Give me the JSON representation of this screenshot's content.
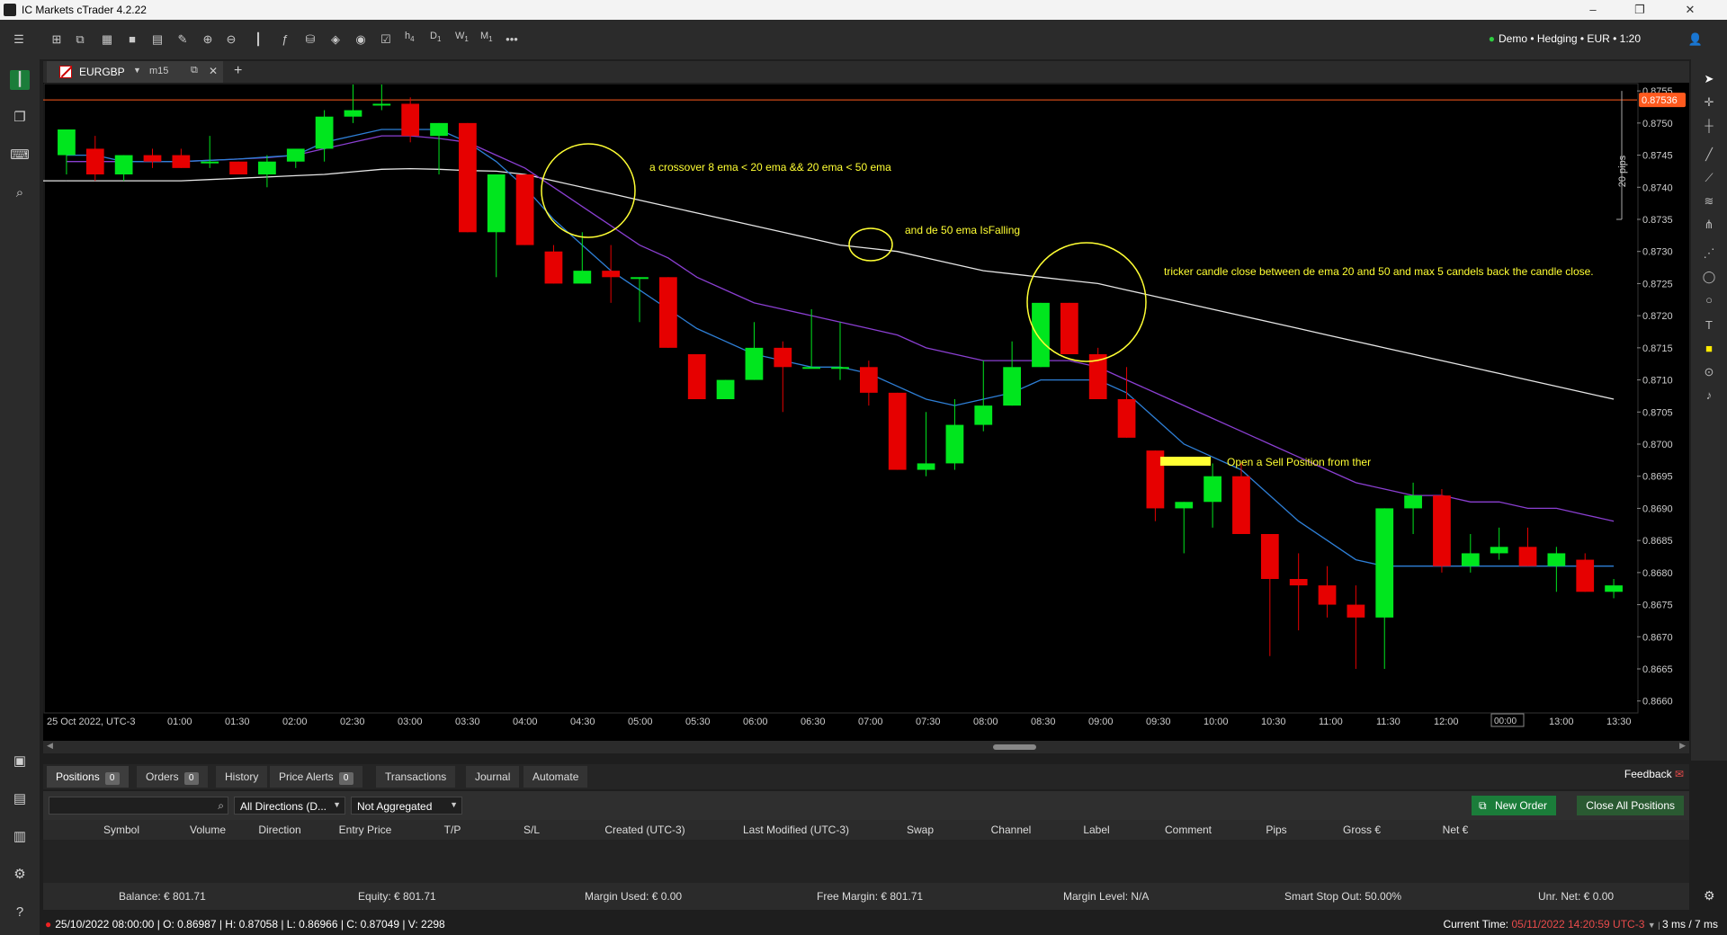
{
  "window": {
    "title": "IC Markets cTrader 4.2.22",
    "buttons": [
      "–",
      "❐",
      "✕"
    ]
  },
  "toolbar": {
    "timeframes": [
      {
        "main": "h",
        "sub": "4"
      },
      {
        "main": "D",
        "sub": "1"
      },
      {
        "main": "W",
        "sub": "1"
      },
      {
        "main": "M",
        "sub": "1"
      }
    ],
    "more": "•••",
    "account": "Demo • Hedging • EUR • 1:20"
  },
  "chart_tab": {
    "symbol": "EURGBP",
    "timeframe": "m15"
  },
  "chart_data": {
    "type": "candlestick",
    "symbol": "EURGBP",
    "timeframe": "m15",
    "ylim": [
      0.8658,
      0.8756
    ],
    "y_ticks": [
      0.8755,
      0.875,
      0.8745,
      0.874,
      0.8735,
      0.873,
      0.8725,
      0.872,
      0.8715,
      0.871,
      0.8705,
      0.87,
      0.8695,
      0.869,
      0.8685,
      0.868,
      0.8675,
      0.867,
      0.8665,
      0.866
    ],
    "x_ticks": [
      "25 Oct 2022, UTC-3",
      "01:00",
      "01:30",
      "02:00",
      "02:30",
      "03:00",
      "03:30",
      "04:00",
      "04:30",
      "05:00",
      "05:30",
      "06:00",
      "06:30",
      "07:00",
      "07:30",
      "08:00",
      "08:30",
      "09:00",
      "09:30",
      "10:00",
      "10:30",
      "11:00",
      "11:30",
      "12:00",
      "12:30",
      "13:00",
      "13:30"
    ],
    "current_price": "0.87536",
    "candles": [
      [
        0.8745,
        0.8747,
        0.8742,
        0.8749
      ],
      [
        0.8746,
        0.8748,
        0.8741,
        0.8742
      ],
      [
        0.8742,
        0.8745,
        0.8741,
        0.8745
      ],
      [
        0.8745,
        0.8746,
        0.8743,
        0.8744
      ],
      [
        0.8745,
        0.8746,
        0.8743,
        0.8743
      ],
      [
        0.8744,
        0.8748,
        0.8743,
        0.8744
      ],
      [
        0.8744,
        0.8744,
        0.8742,
        0.8742
      ],
      [
        0.8742,
        0.8745,
        0.874,
        0.8744
      ],
      [
        0.8744,
        0.8745,
        0.8743,
        0.8746
      ],
      [
        0.8746,
        0.8752,
        0.8744,
        0.8751
      ],
      [
        0.8751,
        0.8756,
        0.875,
        0.8752
      ],
      [
        0.8753,
        0.8756,
        0.8752,
        0.8753
      ],
      [
        0.8753,
        0.8754,
        0.8747,
        0.8748
      ],
      [
        0.8748,
        0.875,
        0.8742,
        0.875
      ],
      [
        0.875,
        0.875,
        0.8733,
        0.8733
      ],
      [
        0.8733,
        0.8742,
        0.8726,
        0.8742
      ],
      [
        0.8742,
        0.8742,
        0.8731,
        0.8731
      ],
      [
        0.873,
        0.8731,
        0.8725,
        0.8725
      ],
      [
        0.8725,
        0.8733,
        0.8725,
        0.8727
      ],
      [
        0.8727,
        0.8731,
        0.8722,
        0.8726
      ],
      [
        0.8726,
        0.8726,
        0.8719,
        0.8726
      ],
      [
        0.8726,
        0.8726,
        0.8715,
        0.8715
      ],
      [
        0.8714,
        0.8714,
        0.8707,
        0.8707
      ],
      [
        0.8707,
        0.871,
        0.8707,
        0.871
      ],
      [
        0.871,
        0.8719,
        0.871,
        0.8715
      ],
      [
        0.8715,
        0.8716,
        0.8705,
        0.8712
      ],
      [
        0.8712,
        0.8721,
        0.8712,
        0.8712
      ],
      [
        0.8712,
        0.8719,
        0.871,
        0.8712
      ],
      [
        0.8712,
        0.8713,
        0.8706,
        0.8708
      ],
      [
        0.8708,
        0.8708,
        0.8696,
        0.8696
      ],
      [
        0.8696,
        0.8705,
        0.8695,
        0.8697
      ],
      [
        0.8697,
        0.8707,
        0.8696,
        0.8703
      ],
      [
        0.8703,
        0.8713,
        0.8702,
        0.8706
      ],
      [
        0.8706,
        0.8716,
        0.8706,
        0.8712
      ],
      [
        0.8712,
        0.8722,
        0.8712,
        0.8722
      ],
      [
        0.8722,
        0.8722,
        0.8714,
        0.8714
      ],
      [
        0.8714,
        0.8715,
        0.8707,
        0.8707
      ],
      [
        0.8707,
        0.8712,
        0.8701,
        0.8701
      ],
      [
        0.8699,
        0.8699,
        0.8688,
        0.869
      ],
      [
        0.869,
        0.8691,
        0.8683,
        0.8691
      ],
      [
        0.8691,
        0.8697,
        0.8687,
        0.8695
      ],
      [
        0.8695,
        0.8697,
        0.8686,
        0.8686
      ],
      [
        0.8686,
        0.8686,
        0.8667,
        0.8679
      ],
      [
        0.8679,
        0.8683,
        0.8671,
        0.8678
      ],
      [
        0.8678,
        0.8681,
        0.8673,
        0.8675
      ],
      [
        0.8675,
        0.8678,
        0.8665,
        0.8673
      ],
      [
        0.8673,
        0.869,
        0.8665,
        0.869
      ],
      [
        0.869,
        0.8694,
        0.8686,
        0.8692
      ],
      [
        0.8692,
        0.8693,
        0.868,
        0.8681
      ],
      [
        0.8681,
        0.8686,
        0.868,
        0.8683
      ],
      [
        0.8683,
        0.8687,
        0.8682,
        0.8684
      ],
      [
        0.8684,
        0.8687,
        0.8681,
        0.8681
      ],
      [
        0.8681,
        0.8684,
        0.8677,
        0.8683
      ],
      [
        0.8682,
        0.8683,
        0.8677,
        0.8677
      ],
      [
        0.8677,
        0.8679,
        0.8676,
        0.8678
      ]
    ],
    "ema_white": [
      0.8741,
      0.8741,
      0.8741,
      0.8741,
      0.8741,
      0.87412,
      0.87414,
      0.87416,
      0.87418,
      0.8742,
      0.87424,
      0.87428,
      0.87429,
      0.87428,
      0.87426,
      0.87425,
      0.8742,
      0.8741,
      0.874,
      0.8739,
      0.8738,
      0.8737,
      0.8736,
      0.8735,
      0.8734,
      0.8733,
      0.8732,
      0.8731,
      0.87305,
      0.873,
      0.8729,
      0.8728,
      0.8727,
      0.87265,
      0.8726,
      0.87255,
      0.8725,
      0.8724,
      0.8723,
      0.8722,
      0.8721,
      0.872,
      0.8719,
      0.8718,
      0.8717,
      0.8716,
      0.8715,
      0.8714,
      0.8713,
      0.8712,
      0.8711,
      0.871,
      0.8709,
      0.8708,
      0.8707
    ],
    "ema_purple": [
      0.8744,
      0.8744,
      0.8744,
      0.8744,
      0.8744,
      0.87442,
      0.87444,
      0.87446,
      0.8745,
      0.8746,
      0.8747,
      0.8748,
      0.8748,
      0.87476,
      0.8747,
      0.8745,
      0.8743,
      0.874,
      0.8737,
      0.8734,
      0.8731,
      0.8729,
      0.8726,
      0.8724,
      0.8722,
      0.8721,
      0.872,
      0.8719,
      0.8718,
      0.8717,
      0.8715,
      0.8714,
      0.8713,
      0.8713,
      0.8713,
      0.8713,
      0.8712,
      0.871,
      0.8708,
      0.8706,
      0.8704,
      0.8702,
      0.87,
      0.8698,
      0.8696,
      0.8694,
      0.8693,
      0.8692,
      0.8692,
      0.8691,
      0.8691,
      0.869,
      0.869,
      0.8689,
      0.8688
    ],
    "ema_blue": [
      0.8745,
      0.8745,
      0.8744,
      0.8744,
      0.8744,
      0.87442,
      0.87444,
      0.87447,
      0.8745,
      0.8747,
      0.8748,
      0.8749,
      0.8749,
      0.8749,
      0.8747,
      0.8744,
      0.874,
      0.8735,
      0.8731,
      0.8727,
      0.8724,
      0.8721,
      0.8718,
      0.8716,
      0.8714,
      0.8713,
      0.8712,
      0.8712,
      0.8711,
      0.8709,
      0.8707,
      0.8706,
      0.8707,
      0.8708,
      0.871,
      0.871,
      0.871,
      0.8708,
      0.8704,
      0.87,
      0.8698,
      0.8696,
      0.8692,
      0.8688,
      0.8685,
      0.8682,
      0.8681,
      0.8681,
      0.8681,
      0.8681,
      0.8681,
      0.8681,
      0.8681,
      0.8681,
      0.8681
    ]
  },
  "annotations": [
    "a crossover 8 ema < 20 ema && 20 ema < 50 ema",
    "and de 50 ema IsFalling",
    "tricker candle close between de ema 20 and 50 and max 5 candels back the candle close.",
    "Open a Sell Position from ther"
  ],
  "pips_label": "20 pips",
  "time_cursor": "00:00",
  "bottom_tabs": [
    {
      "label": "Positions",
      "count": "0"
    },
    {
      "label": "Orders",
      "count": "0"
    },
    {
      "label": "History"
    },
    {
      "label": "Price Alerts",
      "count": "0"
    },
    {
      "label": "Transactions"
    },
    {
      "label": "Journal"
    },
    {
      "label": "Automate"
    }
  ],
  "feedback": "Feedback",
  "filters": {
    "directions": "All Directions (D...",
    "aggregation": "Not Aggregated"
  },
  "buttons": {
    "new_order": "New Order",
    "close_all": "Close All Positions"
  },
  "columns": [
    "Symbol",
    "Volume",
    "Direction",
    "Entry Price",
    "T/P",
    "S/L",
    "Created (UTC-3)",
    "Last Modified (UTC-3)",
    "Swap",
    "Channel",
    "Label",
    "Comment",
    "Pips",
    "Gross €",
    "Net €"
  ],
  "summary": {
    "balance": "Balance: € 801.71",
    "equity": "Equity: € 801.71",
    "margin_used": "Margin Used: € 0.00",
    "free_margin": "Free Margin: € 801.71",
    "margin_level": "Margin Level: N/A",
    "smart_stop": "Smart Stop Out: 50.00%",
    "unr_net": "Unr. Net: € 0.00"
  },
  "status": {
    "ohlc": "25/10/2022 08:00:00 | O: 0.86987 | H: 0.87058 | L: 0.86966 | C: 0.87049 | V: 2298",
    "current_time_label": "Current Time:",
    "current_time": "05/11/2022 14:20:59",
    "tz": "UTC-3",
    "latency": "3 ms / 7 ms"
  },
  "colors": {
    "bull": "#00e61e",
    "bear": "#e60000",
    "annotation": "#ffff33",
    "price_line": "#ff5a1e"
  }
}
